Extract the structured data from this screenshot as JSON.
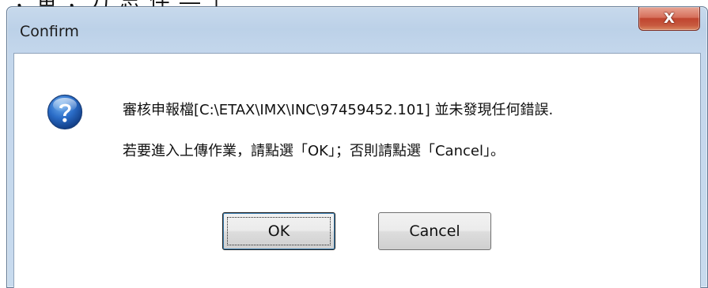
{
  "background": {
    "partial_text": "，鱼 ，刀 忘 件 ―  」"
  },
  "dialog": {
    "title": "Confirm",
    "close_label": "X",
    "icon": "question-icon",
    "message_line1": "審核申報檔[C:\\ETAX\\IMX\\INC\\97459452.101] 並未發現任何錯誤.",
    "message_line2": "若要進入上傳作業，請點選「OK」；否則請點選「Cancel」。",
    "buttons": {
      "ok_label": "OK",
      "cancel_label": "Cancel"
    }
  },
  "colors": {
    "frame": "#c8dbee",
    "close_button": "#c7503a",
    "icon_blue": "#1f5fb5",
    "focus_border": "#3c7fb1"
  }
}
